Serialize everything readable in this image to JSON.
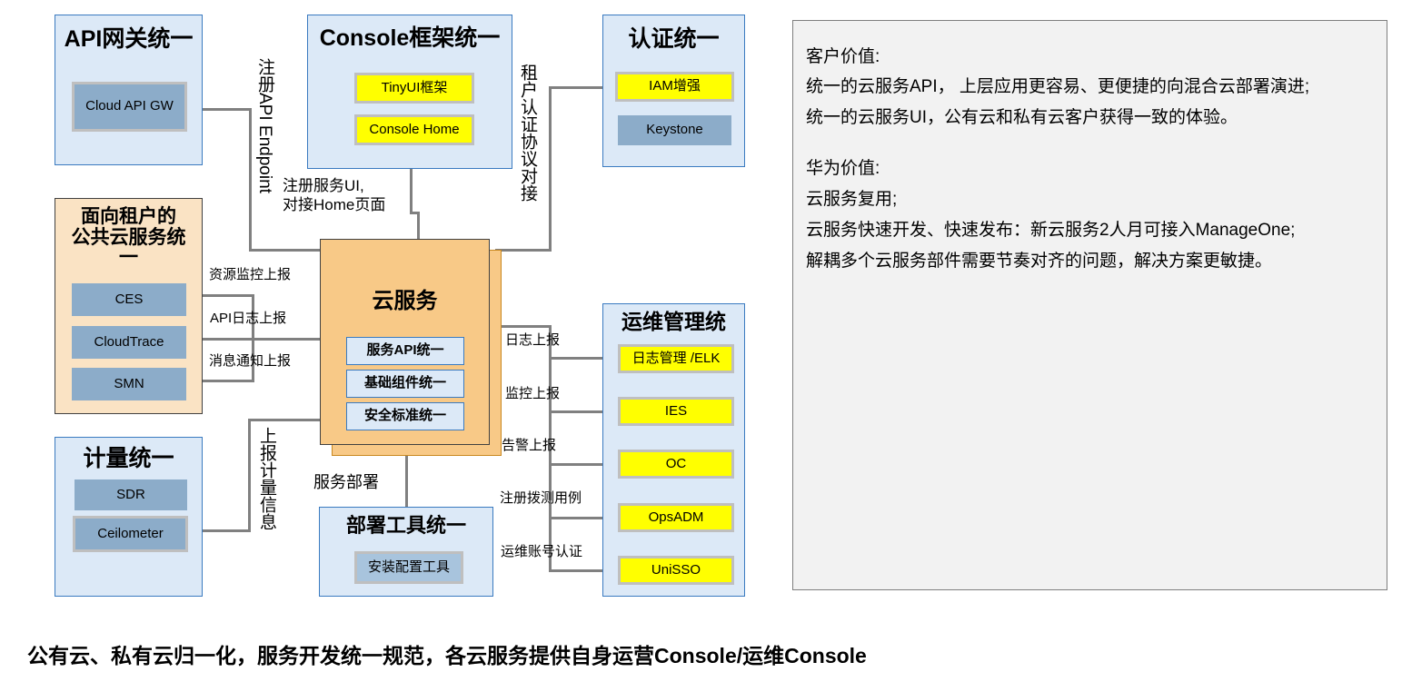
{
  "diagram": {
    "groups": [
      {
        "id": "api-gateway",
        "title": "API网关统一",
        "items": [
          {
            "label": "Cloud API GW",
            "style": "blue"
          }
        ]
      },
      {
        "id": "console-framework",
        "title": "Console框架统一",
        "items": [
          {
            "label": "TinyUI框架",
            "style": "yellow"
          },
          {
            "label": "Console Home",
            "style": "yellow"
          }
        ]
      },
      {
        "id": "auth",
        "title": "认证统一",
        "items": [
          {
            "label": "IAM增强",
            "style": "yellow"
          },
          {
            "label": "Keystone",
            "style": "blue-noshadow"
          }
        ]
      },
      {
        "id": "tenant-public-cloud",
        "title": "面向租户的\n公共云服务统\n一",
        "items": [
          {
            "label": "CES",
            "style": "blue-noshadow"
          },
          {
            "label": "CloudTrace",
            "style": "blue-noshadow"
          },
          {
            "label": "SMN",
            "style": "blue-noshadow"
          }
        ]
      },
      {
        "id": "metering",
        "title": "计量统一",
        "items": [
          {
            "label": "SDR",
            "style": "blue-noshadow"
          },
          {
            "label": "Ceilometer",
            "style": "blue"
          }
        ]
      },
      {
        "id": "deploy-tool",
        "title": "部署工具统一",
        "items": [
          {
            "label": "安装配置工具",
            "style": "greyblue"
          }
        ]
      },
      {
        "id": "ops-management",
        "title": "运维管理统",
        "items": [
          {
            "label": "日志管理 /ELK",
            "style": "yellow"
          },
          {
            "label": "IES",
            "style": "yellow"
          },
          {
            "label": "OC",
            "style": "yellow"
          },
          {
            "label": "OpsADM",
            "style": "yellow"
          },
          {
            "label": "UniSSO",
            "style": "yellow"
          }
        ]
      }
    ],
    "center": {
      "title": "云服务",
      "items": [
        "服务API统一",
        "基础组件统一",
        "安全标准统一"
      ]
    },
    "connector_labels": {
      "register_api_endpoint": "注册API Endpoint",
      "register_service_ui": "注册服务UI,\n对接Home页面",
      "tenant_auth_protocol": "租户认证协议对接",
      "resource_monitor_report": "资源监控上报",
      "api_log_report": "API日志上报",
      "message_notify_report": "消息通知上报",
      "report_metering_info": "上报计量信息",
      "service_deploy": "服务部署",
      "log_report": "日志上报",
      "monitor_report": "监控上报",
      "alarm_report": "告警上报",
      "register_dial_test": "注册拨测用例",
      "ops_account_auth": "运维账号认证"
    }
  },
  "value_panel": {
    "sections": [
      {
        "heading": "客户价值:",
        "lines": [
          "统一的云服务API， 上层应用更容易、更便捷的向混合云部署演进;",
          "统一的云服务UI，公有云和私有云客户获得一致的体验。"
        ]
      },
      {
        "heading": "华为价值:",
        "lines": [
          "云服务复用;",
          "云服务快速开发、快速发布：新云服务2人月可接入ManageOne;",
          "解耦多个云服务部件需要节奏对齐的问题，解决方案更敏捷。"
        ]
      }
    ]
  },
  "footer": {
    "caption": "公有云、私有云归一化，服务开发统一规范，各云服务提供自身运营Console/运维Console"
  },
  "colors": {
    "group_border_blue": "#3a7ac0",
    "group_fill_blue": "#dce9f7",
    "group_fill_orange": "#fae3c4",
    "chip_blue": "#8cacc9",
    "chip_yellow": "#ffff00",
    "center_fill": "#f8c987",
    "connector_grey": "#808080",
    "panel_fill": "#f2f2f2"
  }
}
